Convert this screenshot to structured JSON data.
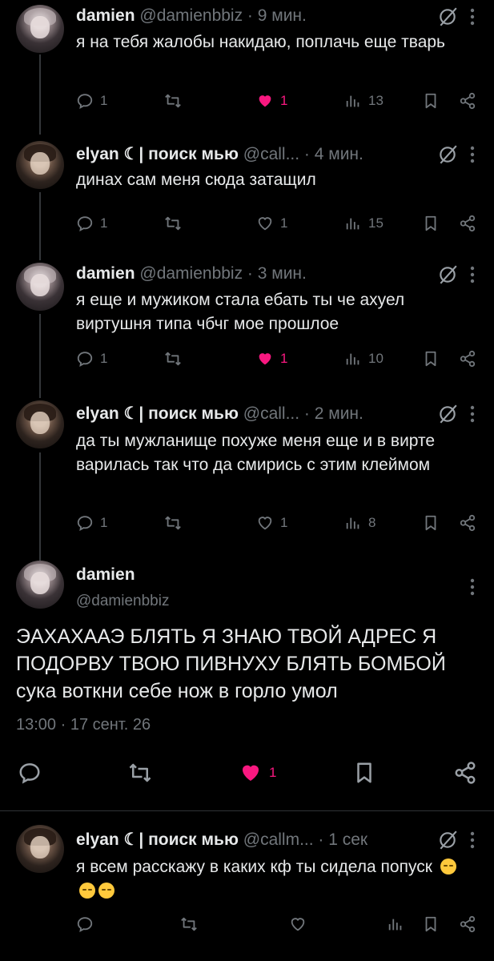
{
  "tweets": [
    {
      "name": "damien",
      "handle": "@damienbbiz · 9 мин.",
      "text": "я на тебя жалобы накидаю, поплачь еще тварь",
      "replies": "1",
      "likes": "1",
      "views": "13",
      "liked": true
    },
    {
      "name": "elyan ☾| поиск мью",
      "handle": "@call... · 4 мин.",
      "text": "динах сам меня сюда затащил",
      "replies": "1",
      "likes": "1",
      "views": "15",
      "liked": false
    },
    {
      "name": "damien",
      "handle": "@damienbbiz · 3 мин.",
      "text": "я еще и мужиком стала ебать ты че ахуел виртушня типа чбчг мое прошлое",
      "replies": "1",
      "likes": "1",
      "views": "10",
      "liked": true
    },
    {
      "name": "elyan ☾| поиск мью",
      "handle": "@call... · 2 мин.",
      "text": "да ты мужланище похуже меня еще и в вирте варилась так что да смирись с этим клеймом",
      "replies": "1",
      "likes": "1",
      "views": "8",
      "liked": false
    }
  ],
  "main_tweet": {
    "name": "damien",
    "handle": "@damienbbiz",
    "text": "ЭАХАХААЭ БЛЯТЬ Я ЗНАЮ ТВОЙ АДРЕС Я ПОДОРВУ ТВОЮ ПИВНУХУ БЛЯТЬ БОМБОЙ сука воткни себе нож в горло умол",
    "timestamp": "13:00 · 17 сент. 26",
    "likes": "1"
  },
  "reply": {
    "name": "elyan ☾| поиск мью",
    "handle": "@callm... · 1 сек",
    "text": "я всем расскажу в каких кф ты сидела попуск"
  },
  "colors": {
    "background": "#000000",
    "text": "#e7e9ea",
    "muted": "#71767b",
    "like": "#f91880"
  }
}
